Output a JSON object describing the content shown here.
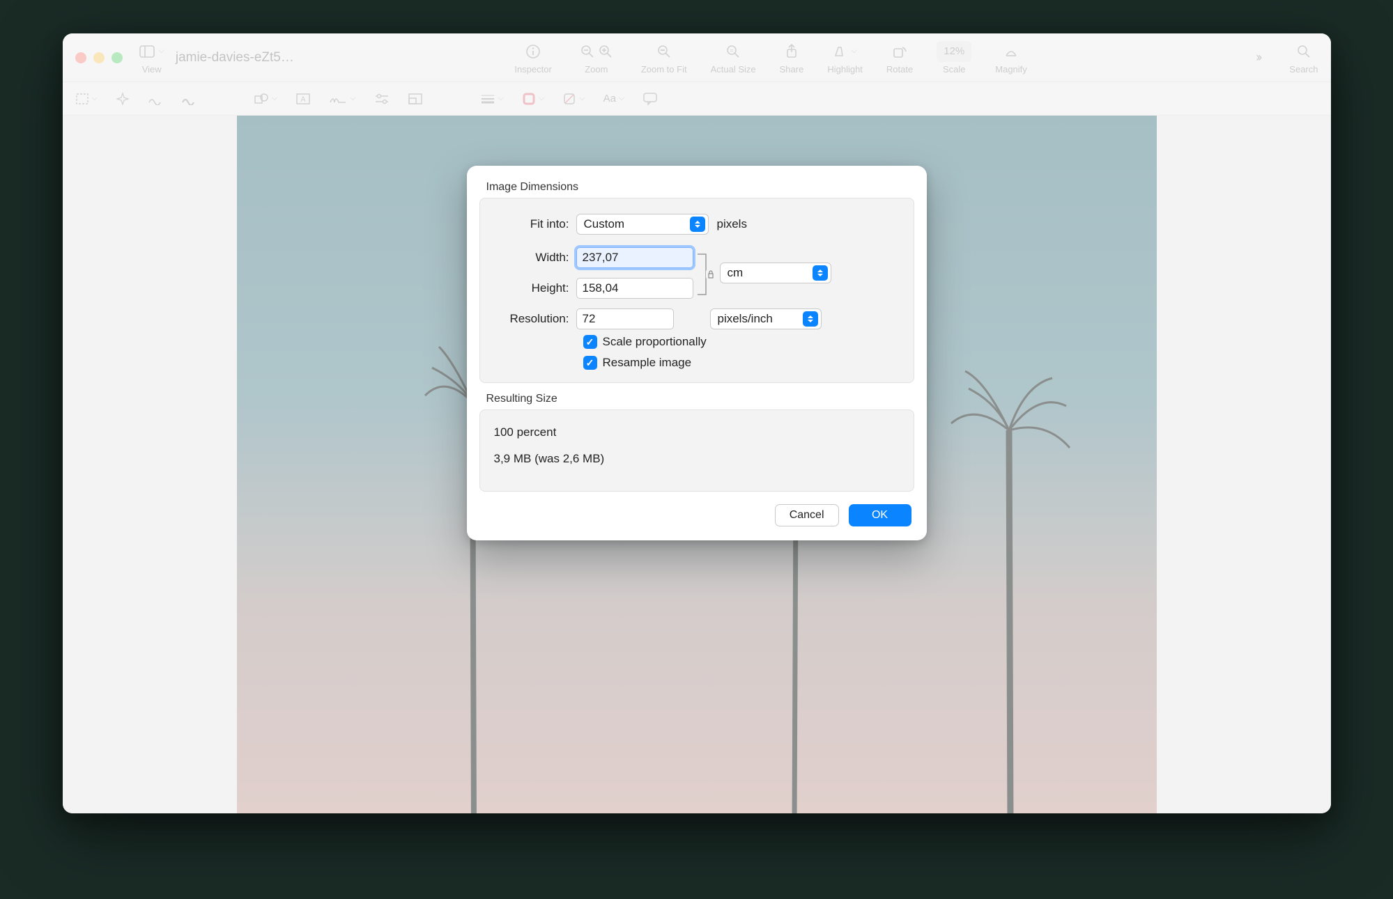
{
  "window": {
    "title": "jamie-davies-eZt5…"
  },
  "toolbar": {
    "view": "View",
    "inspector": "Inspector",
    "zoom": "Zoom",
    "zoom_to_fit": "Zoom to Fit",
    "actual_size": "Actual Size",
    "share": "Share",
    "highlight": "Highlight",
    "rotate": "Rotate",
    "scale": "Scale",
    "scale_value": "12%",
    "magnify": "Magnify",
    "search": "Search"
  },
  "dialog": {
    "section_dimensions": "Image Dimensions",
    "fit_into_label": "Fit into:",
    "fit_into_value": "Custom",
    "fit_into_unit": "pixels",
    "width_label": "Width:",
    "width_value": "237,07",
    "height_label": "Height:",
    "height_value": "158,04",
    "wh_unit": "cm",
    "resolution_label": "Resolution:",
    "resolution_value": "72",
    "resolution_unit": "pixels/inch",
    "scale_proportionally": "Scale proportionally",
    "resample_image": "Resample image",
    "section_resulting": "Resulting Size",
    "resulting_percent": "100 percent",
    "resulting_size": "3,9 MB (was 2,6 MB)",
    "cancel": "Cancel",
    "ok": "OK"
  }
}
